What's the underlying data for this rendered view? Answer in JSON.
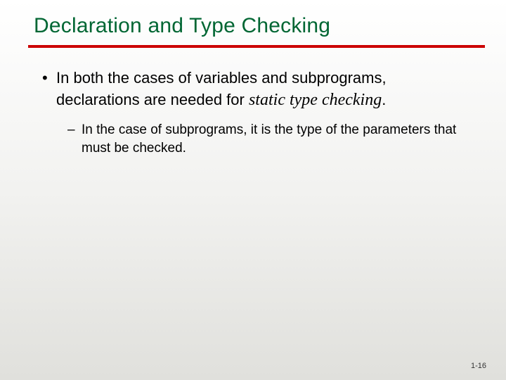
{
  "title": "Declaration and Type Checking",
  "bullets": {
    "main": {
      "part1": "In both the cases of variables and subprograms, declarations are needed for ",
      "italic": "static type checking",
      "part2": "."
    },
    "sub": "In the case of subprograms, it is the type of the parameters that must be checked."
  },
  "page_number": "1-16",
  "colors": {
    "title": "#006633",
    "rule": "#cc0000"
  }
}
